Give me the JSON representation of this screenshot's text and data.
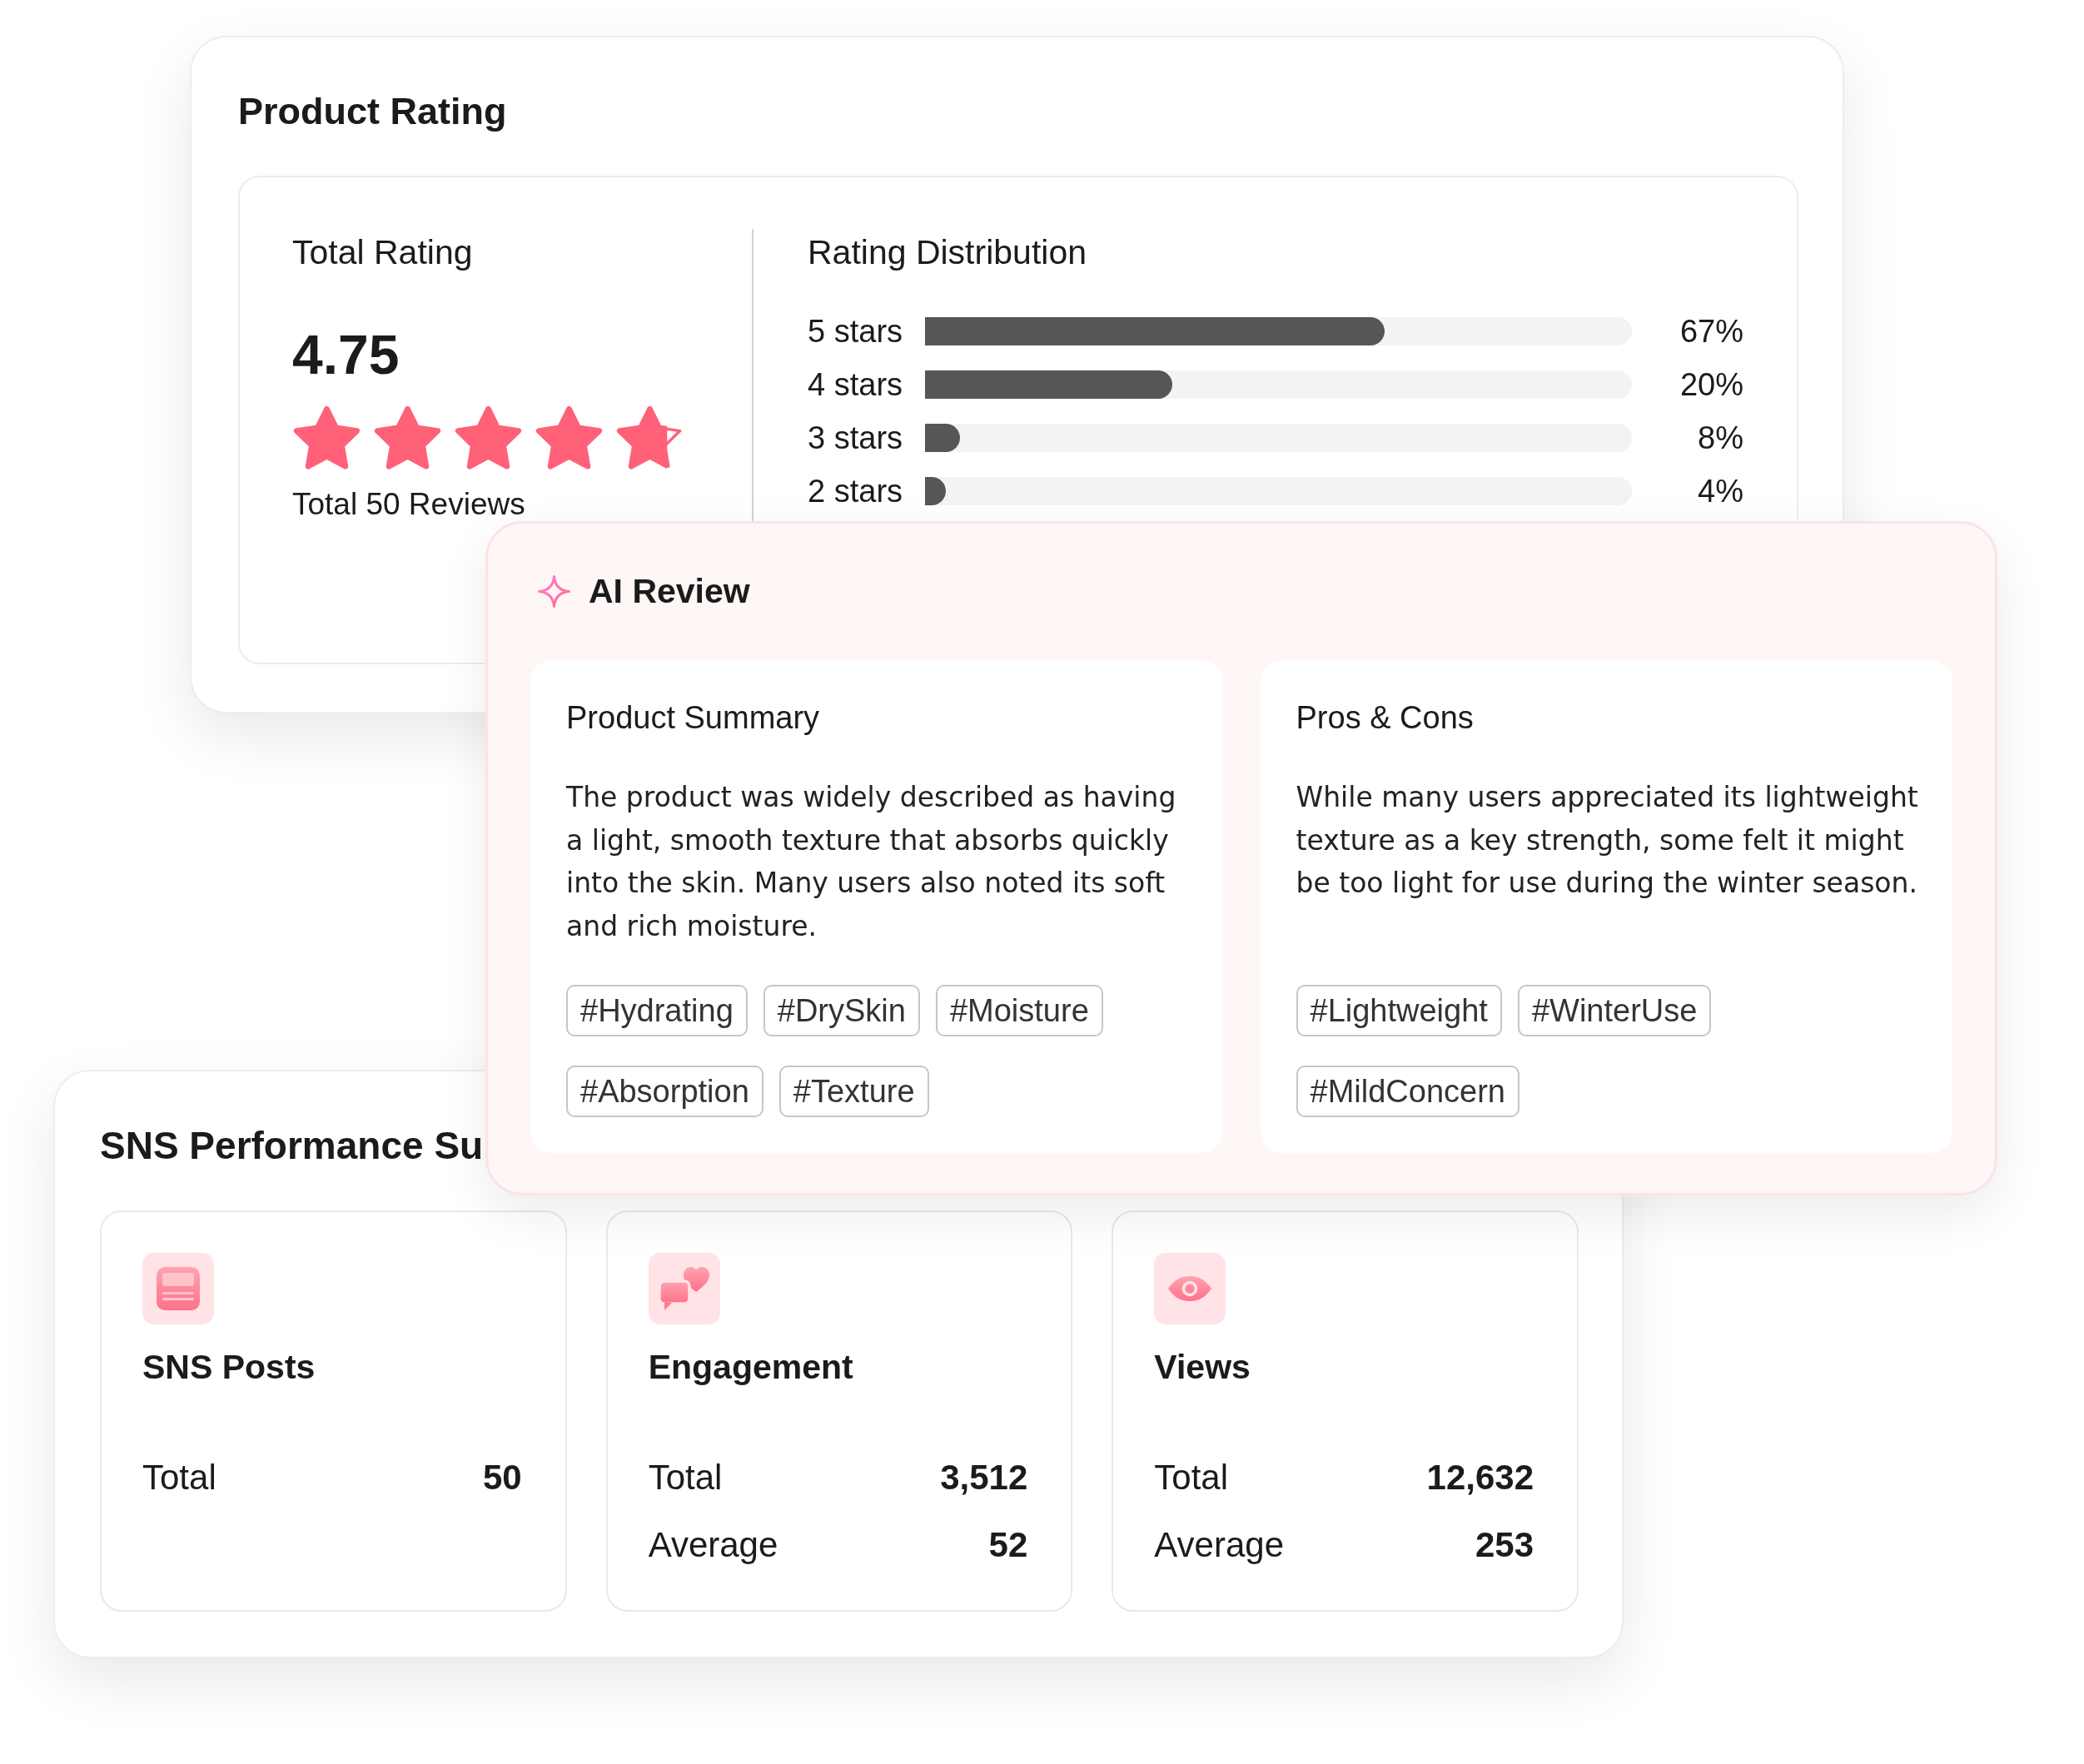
{
  "product_rating": {
    "title": "Product Rating",
    "total_rating": {
      "label": "Total Rating",
      "score": "4.75",
      "stars": 4.75,
      "reviews": "Total 50 Reviews"
    },
    "distribution": {
      "title": "Rating Distribution",
      "rows": [
        {
          "label": "5 stars",
          "level": 0.65,
          "percent": "67%"
        },
        {
          "label": "4 stars",
          "level": 0.35,
          "percent": "20%"
        },
        {
          "label": "3 stars",
          "level": 0.05,
          "percent": "8%"
        },
        {
          "label": "2 stars",
          "level": 0.03,
          "percent": "4%"
        }
      ]
    }
  },
  "ai_review": {
    "title": "AI Review",
    "sections": [
      {
        "title": "Product Summary",
        "text": "The product was widely described as having a light, smooth texture that absorbs quickly into the skin. Many users also noted its soft and rich moisture.",
        "tags": [
          "#Hydrating",
          "#DrySkin",
          "#Moisture",
          "#Absorption",
          "#Texture"
        ]
      },
      {
        "title": "Pros & Cons",
        "text": "While many users appreciated its lightweight texture as a key strength, some felt it might be too light for use during the winter season.",
        "tags": [
          "#Lightweight",
          "#WinterUse",
          "#MildConcern"
        ]
      }
    ]
  },
  "sns_performance": {
    "title": "SNS Performance Su",
    "cards": [
      {
        "kind": "posts",
        "title": "SNS Posts",
        "stats": [
          {
            "label": "Total",
            "value": "50"
          }
        ]
      },
      {
        "kind": "engagement",
        "title": "Engagement",
        "stats": [
          {
            "label": "Total",
            "value": "3,512"
          },
          {
            "label": "Average",
            "value": "52"
          }
        ]
      },
      {
        "kind": "views",
        "title": "Views",
        "stats": [
          {
            "label": "Total",
            "value": "12,632"
          },
          {
            "label": "Average",
            "value": "253"
          }
        ]
      }
    ]
  }
}
